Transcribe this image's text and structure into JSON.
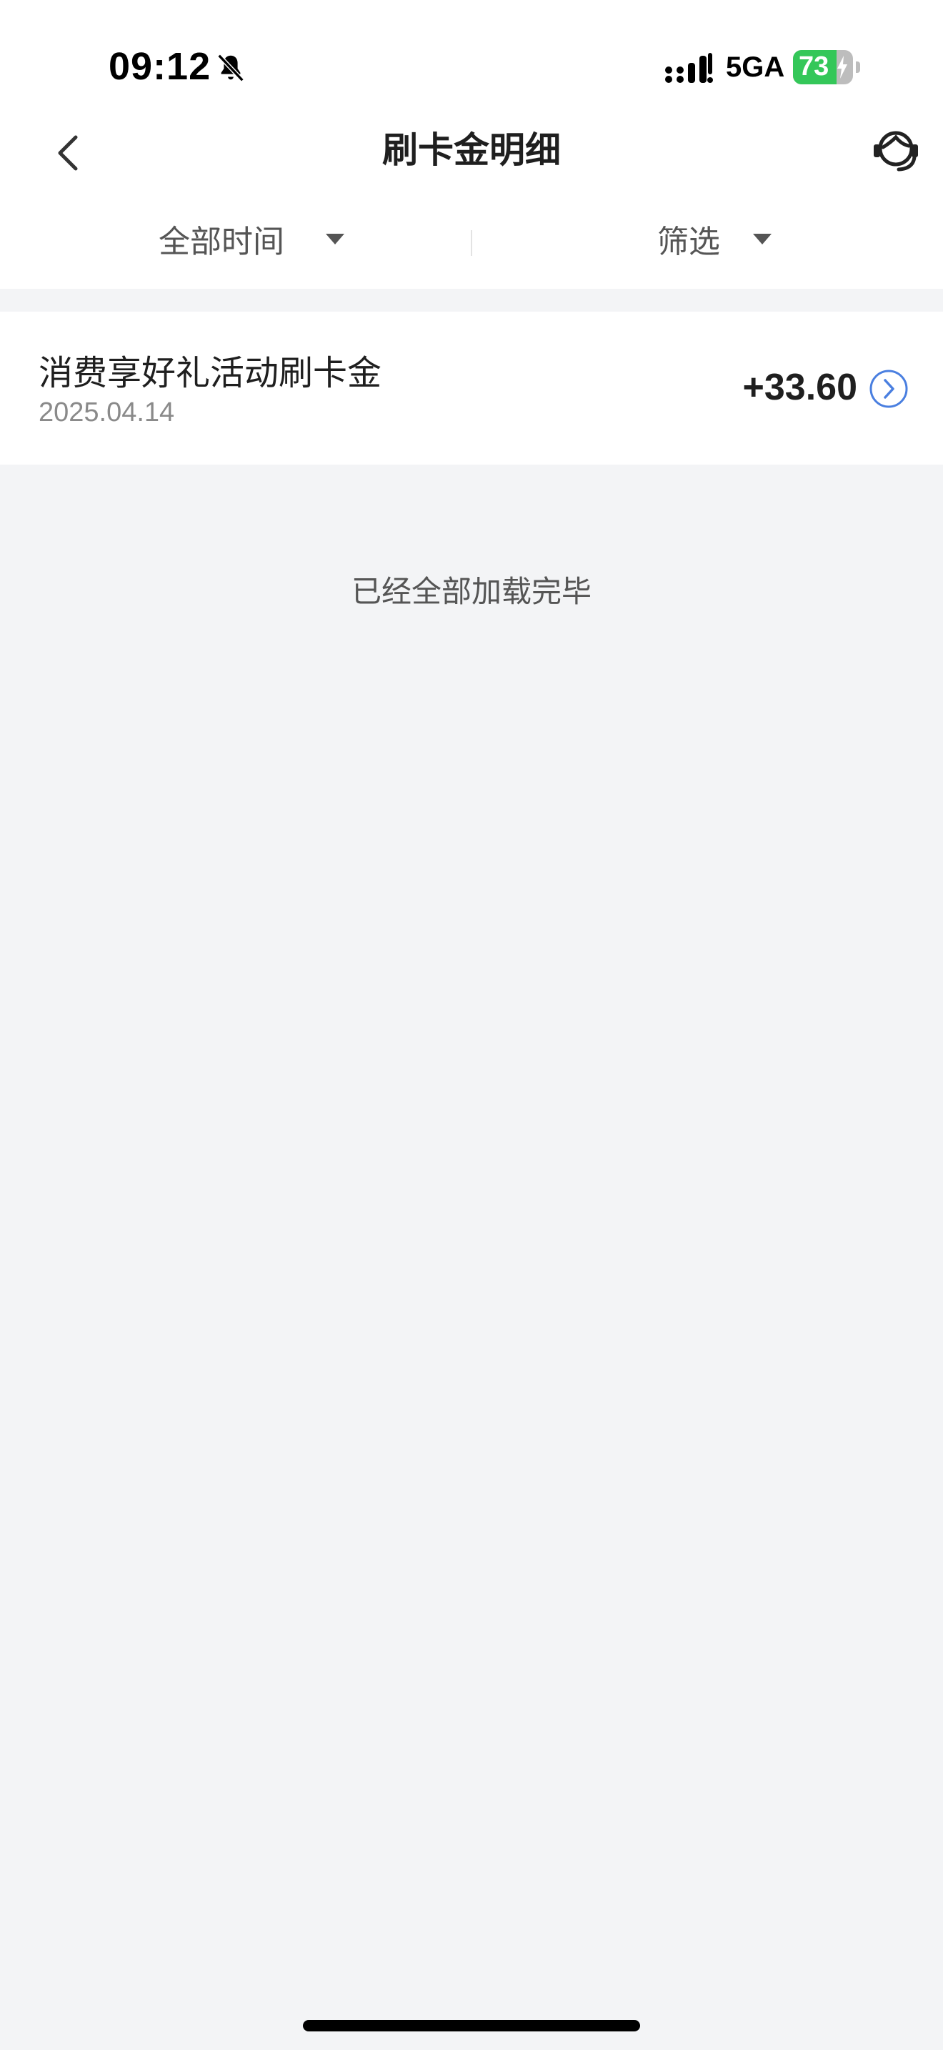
{
  "status_bar": {
    "time": "09:12",
    "network": "5GA",
    "battery_level": "73",
    "battery_fraction": 0.73,
    "icons": [
      "bell-muted-icon",
      "signal-icon",
      "charging-bolt-icon"
    ]
  },
  "header": {
    "title": "刷卡金明细",
    "back_icon": "chevron-left-icon",
    "service_icon": "customer-service-icon"
  },
  "filters": {
    "time_label": "全部时间",
    "screen_label": "筛选",
    "caret_icon": "caret-down-icon"
  },
  "records": [
    {
      "title": "消费享好礼活动刷卡金",
      "date": "2025.04.14",
      "amount": "+33.60",
      "detail_icon": "chevron-right-circle-icon"
    }
  ],
  "footer": {
    "loaded_text": "已经全部加载完毕"
  },
  "colors": {
    "accent": "#4a7fe0",
    "battery_green": "#34c759",
    "background": "#f3f4f6"
  }
}
